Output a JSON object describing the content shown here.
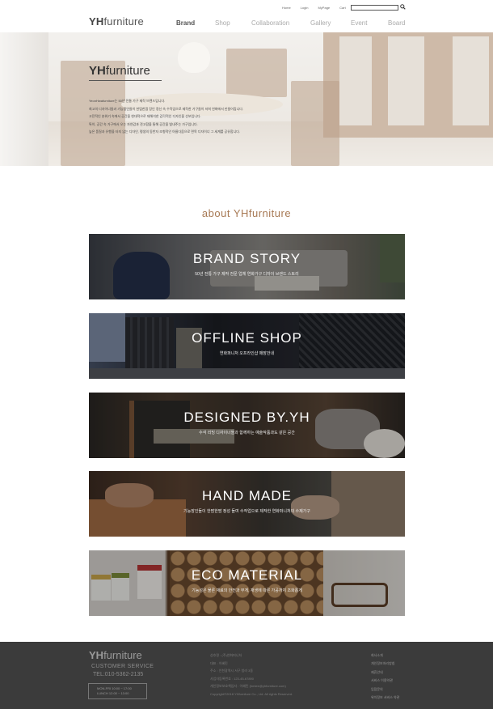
{
  "header": {
    "logo_bold": "YH",
    "logo_rest": "furniture",
    "util_links": [
      "Home",
      "Login",
      "MyPage",
      "Cart"
    ],
    "search_placeholder": "",
    "nav": [
      "Brand",
      "Shop",
      "Collaboration",
      "Gallery",
      "Event",
      "Board"
    ],
    "active_nav": "Brand"
  },
  "hero": {
    "title_bold": "YH",
    "title_rest": "furniture",
    "lines": [
      "YeonHwafurniture는 50년 전통 가구 제작 브랜드입니다.",
      "최고의 디자이너들과 기능장인들이 한땀한땀 장인 정신 속 수작업으로 제작한 가구들이 저희 연화에서 만들어집니다.",
      "고전적인 분위기 속에서 공간을 현대적으로 재해석한 감각적인 디자인을 선보입니다.",
      "특히, 공간 속 가구에서 오는 자연감과 견고함을 통해 공간을 빛내주는 가구입니다.",
      "높은 품질과 유행을 타지 않는 디자인, 평생의 동반자 조형적인 아름다움으로 면목 디자이너 그 세계를 공유합니다."
    ]
  },
  "about_heading": "about YHfurniture",
  "banners": [
    {
      "title": "BRAND STORY",
      "subtitle": "50년 전통 가구 제작 전문 업체 연화가구 디자이 브랜드 스토리"
    },
    {
      "title": "OFFLINE SHOP",
      "subtitle": "연화퍼니처 오프라인샵 매장안내"
    },
    {
      "title": "DESIGNED BY.YH",
      "subtitle": "수석 리빙 디자이너들과 함께하는 예술작품과도 같은 공간"
    },
    {
      "title": "HAND MADE",
      "subtitle": "기능장인들이 한땀한땀 정성 들여 수작업으로 제작한 연화퍼니처의 수제가구"
    },
    {
      "title": "ECO MATERIAL",
      "subtitle": "기능성은 물론 재료의 안전과 무게, 재생에 따른 가공까지 조화롭게"
    }
  ],
  "footer": {
    "logo_bold": "YH",
    "logo_rest": "furniture",
    "cs_label": "CUSTOMER SERVICE",
    "tel": "TEL:010-5362-2135",
    "hours_mon": "MON-FRI  10:00 ~ 17:00",
    "hours_lunch": "LUNCH  12:00 ~ 13:00",
    "info_lines": [
      "상호명 : (주)연화퍼니처",
      "대표 : 이혜민",
      "주소 : 인천광역시 서구 청라 3동",
      "사업자등록번호 : 123-45-67890",
      "개인정보보호책임자 : 이혜민 (hmlee@yhfurniture.com)",
      "Copyright©2018 YHfurniture Co., Ltd. All rights Reserved."
    ],
    "links": [
      "회사소개",
      "개인정보처리방침",
      "제휴안내",
      "서비스 이용약관",
      "입점문의",
      "위치정보 서비스 약관"
    ]
  },
  "colors": {
    "accent": "#a87a55",
    "footer_bg": "#3b3b3b"
  }
}
